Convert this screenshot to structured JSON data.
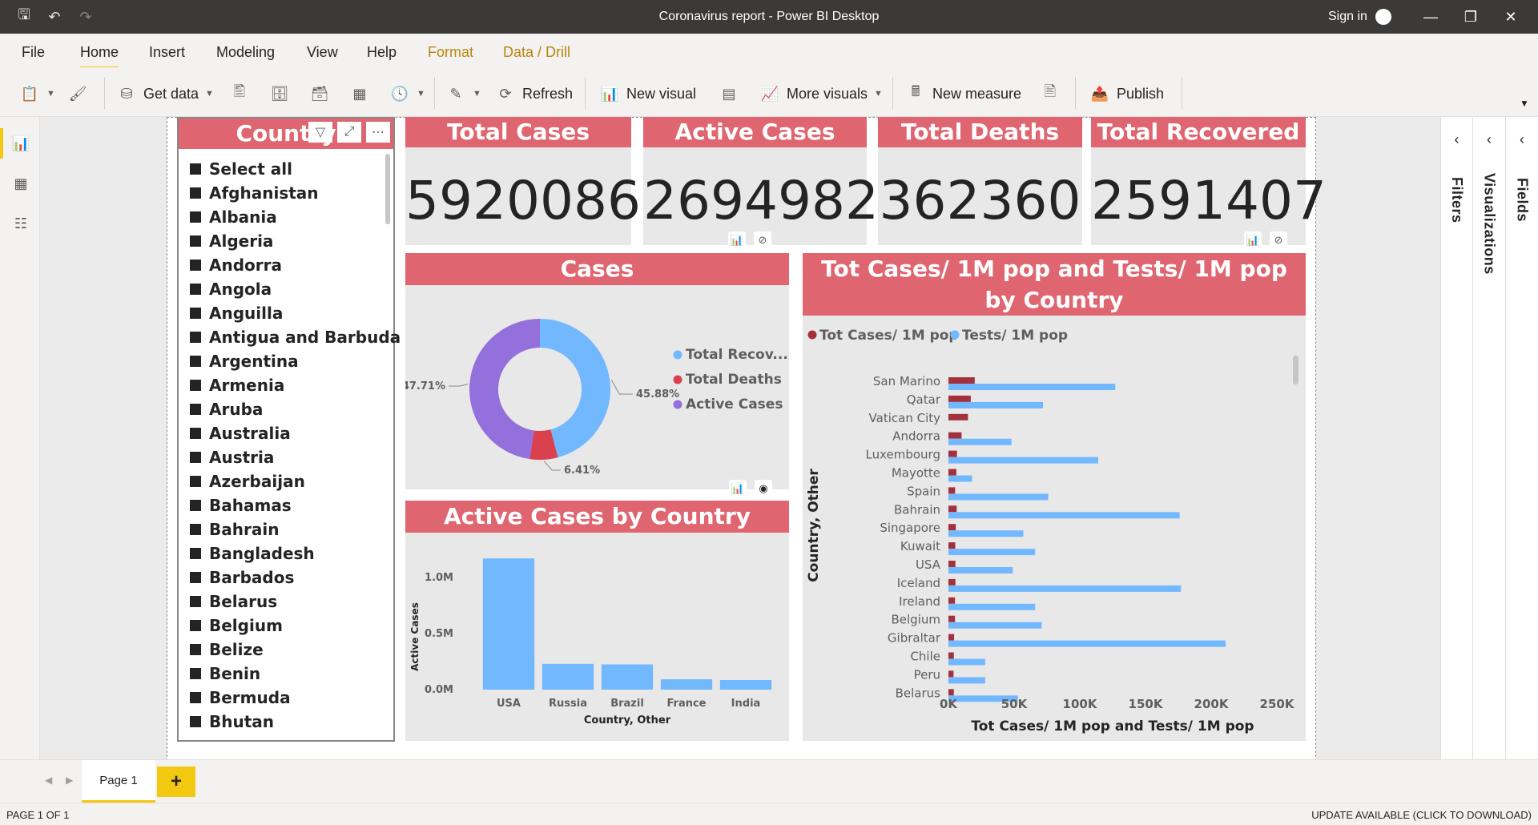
{
  "window": {
    "title": "Coronavirus report - Power BI Desktop",
    "sign_in": "Sign in"
  },
  "menu": {
    "tabs": [
      "File",
      "Home",
      "Insert",
      "Modeling",
      "View",
      "Help",
      "Format",
      "Data / Drill"
    ],
    "active": "Home"
  },
  "ribbon": {
    "get_data": "Get data",
    "refresh": "Refresh",
    "new_visual": "New visual",
    "more_visuals": "More visuals",
    "new_measure": "New measure",
    "publish": "Publish"
  },
  "panes": {
    "filters": "Filters",
    "visualizations": "Visualizations",
    "fields": "Fields"
  },
  "slicer": {
    "title": "Country",
    "items": [
      "Select all",
      "Afghanistan",
      "Albania",
      "Algeria",
      "Andorra",
      "Angola",
      "Anguilla",
      "Antigua and Barbuda",
      "Argentina",
      "Armenia",
      "Aruba",
      "Australia",
      "Austria",
      "Azerbaijan",
      "Bahamas",
      "Bahrain",
      "Bangladesh",
      "Barbados",
      "Belarus",
      "Belgium",
      "Belize",
      "Benin",
      "Bermuda",
      "Bhutan"
    ]
  },
  "cards": [
    {
      "title": "Total Cases",
      "value": "5920086"
    },
    {
      "title": "Active Cases",
      "value": "2694982"
    },
    {
      "title": "Total Deaths",
      "value": "362360"
    },
    {
      "title": "Total Recovered",
      "value": "2591407"
    }
  ],
  "colors": {
    "header": "#df6670",
    "recovered": "#72b8ff",
    "deaths": "#d9414f",
    "active": "#9370db",
    "tot_cases_1m": "#a3303d",
    "tests_1m": "#72b8ff",
    "bar": "#72b8ff"
  },
  "chart_data": [
    {
      "type": "pie",
      "title": "Cases",
      "slices": [
        {
          "name": "Total Recov...",
          "value": 45.88,
          "label": "45.88%",
          "color": "#72b8ff"
        },
        {
          "name": "Total Deaths",
          "value": 6.41,
          "label": "6.41%",
          "color": "#d9414f"
        },
        {
          "name": "Active Cases",
          "value": 47.71,
          "label": "47.71%",
          "color": "#9370db"
        }
      ],
      "legend": "right"
    },
    {
      "type": "bar",
      "title": "Active Cases by Country",
      "xlabel": "Country, Other",
      "ylabel": "Active Cases",
      "categories": [
        "USA",
        "Russia",
        "Brazil",
        "France",
        "India"
      ],
      "values": [
        1170000,
        230000,
        225000,
        92000,
        86000
      ],
      "ylim": [
        0,
        1250000
      ],
      "yticks": [
        {
          "v": 0,
          "label": "0.0M"
        },
        {
          "v": 500000,
          "label": "0.5M"
        },
        {
          "v": 1000000,
          "label": "1.0M"
        }
      ]
    },
    {
      "type": "bar",
      "orientation": "horizontal",
      "title": "Tot Cases/ 1M pop and Tests/ 1M pop by Country",
      "xlabel": "Tot Cases/ 1M pop and Tests/ 1M pop",
      "ylabel": "Country, Other",
      "legend": "top-left",
      "categories": [
        "San Marino",
        "Qatar",
        "Vatican City",
        "Andorra",
        "Luxembourg",
        "Mayotte",
        "Spain",
        "Bahrain",
        "Singapore",
        "Kuwait",
        "USA",
        "Iceland",
        "Ireland",
        "Belgium",
        "Gibraltar",
        "Chile",
        "Peru",
        "Belarus"
      ],
      "series": [
        {
          "name": "Tot Cases/ 1M pop",
          "values": [
            20000,
            17000,
            14900,
            10000,
            6500,
            6000,
            5100,
            6300,
            5600,
            5200,
            5300,
            5300,
            5000,
            5000,
            4300,
            4100,
            3900,
            4100
          ]
        },
        {
          "name": "Tests/ 1M pop",
          "values": [
            127000,
            72000,
            0,
            48000,
            114000,
            18000,
            76000,
            176000,
            57000,
            66000,
            49000,
            177000,
            66000,
            71000,
            211000,
            28000,
            28000,
            53000
          ]
        }
      ],
      "xlim": [
        0,
        250000
      ],
      "xticks": [
        {
          "v": 0,
          "label": "0K"
        },
        {
          "v": 50000,
          "label": "50K"
        },
        {
          "v": 100000,
          "label": "100K"
        },
        {
          "v": 150000,
          "label": "150K"
        },
        {
          "v": 200000,
          "label": "200K"
        },
        {
          "v": 250000,
          "label": "250K"
        }
      ]
    }
  ],
  "pagebar": {
    "page_tab": "Page 1",
    "add": "+"
  },
  "status": {
    "page": "PAGE 1 OF 1",
    "update": "UPDATE AVAILABLE (CLICK TO DOWNLOAD)"
  }
}
